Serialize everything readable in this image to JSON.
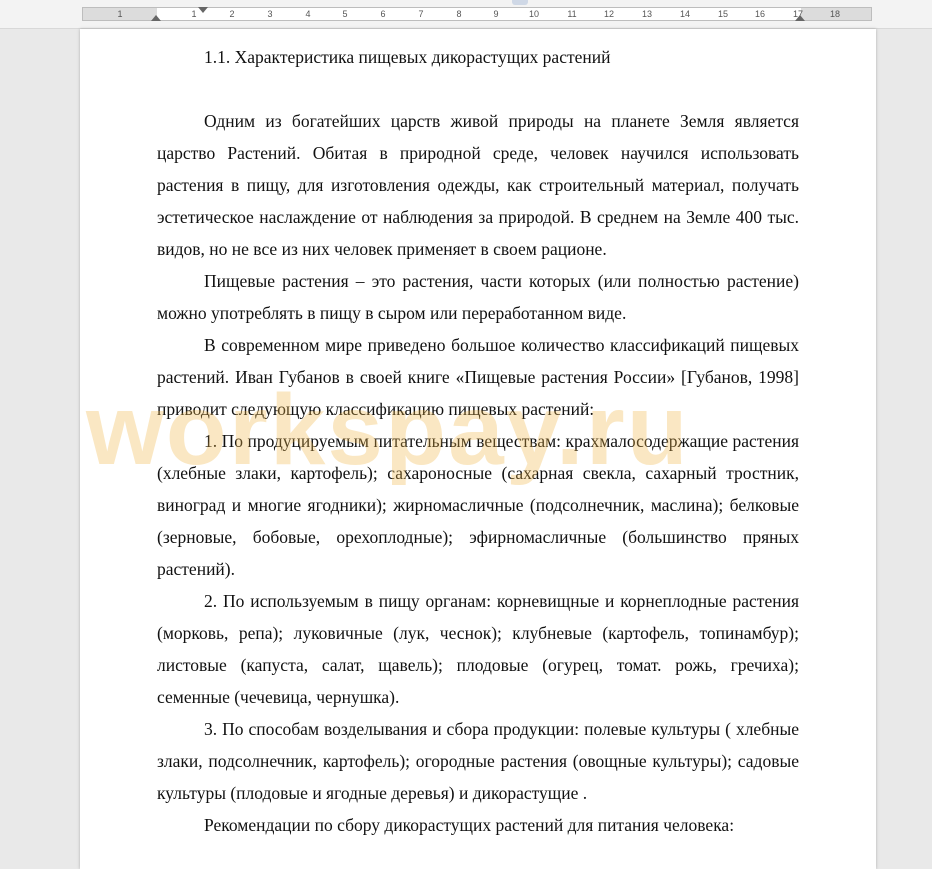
{
  "ruler": {
    "numbers": [
      "1",
      "1",
      "2",
      "3",
      "4",
      "5",
      "6",
      "7",
      "8",
      "9",
      "10",
      "11",
      "12",
      "13",
      "14",
      "15",
      "16",
      "17",
      "18"
    ]
  },
  "document": {
    "heading": "1.1. Характеристика пищевых дикорастущих растений",
    "paragraphs": [
      "Одним из богатейших царств живой природы на планете Земля является царство Растений. Обитая в природной среде, человек научился использовать растения в пищу, для изготовления одежды, как строительный материал, получать эстетическое наслаждение от наблюдения за природой. В среднем на Земле 400 тыс. видов, но не все из них человек применяет в своем рационе.",
      "Пищевые растения – это растения, части которых (или полностью растение) можно употреблять в пищу в сыром или переработанном виде.",
      "В современном мире приведено большое количество классификаций пищевых растений. Иван Губанов в своей книге «Пищевые растения России» [Губанов, 1998] приводит следующую классификацию пищевых растений:",
      "1. По продуцируемым питательным веществам: крахмалосодержащие растения (хлебные злаки, картофель); сахароносные (сахарная свекла, сахарный тростник, виноград и многие ягодники); жирномасличные (подсолнечник, маслина); белковые (зерновые, бобовые, орехоплодные); эфирномасличные (большинство пряных растений).",
      "2. По используемым в пищу органам: корневищные и корнеплодные растения (морковь, репа); луковичные (лук, чеснок); клубневые (картофель, топинамбур); листовые (капуста, салат, щавель); плодовые (огурец, томат. рожь, гречиха); семенные (чечевица, чернушка).",
      "3. По способам возделывания и сбора продукции: полевые культуры ( хлебные злаки, подсолнечник, картофель); огородные растения (овощные культуры); садовые культуры (плодовые и ягодные деревья) и дикорастущие .",
      "Рекомендации по сбору дикорастущих растений для питания человека:"
    ]
  },
  "watermark": "workspay.ru"
}
